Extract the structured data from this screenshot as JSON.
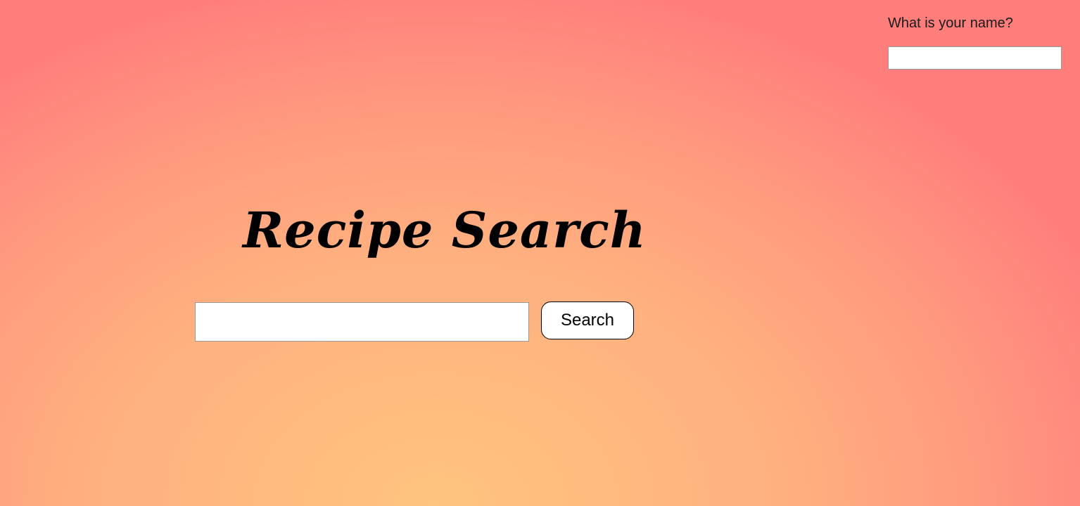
{
  "name_prompt": {
    "label": "What is your name?",
    "value": "",
    "placeholder": ""
  },
  "main": {
    "title": "Recipe Search",
    "search_value": "",
    "search_placeholder": "",
    "search_button_label": "Search"
  },
  "colors": {
    "background_center": "#ffc47f",
    "background_edge": "#ff7e7c",
    "input_background": "#ffffff",
    "text": "#000000"
  }
}
